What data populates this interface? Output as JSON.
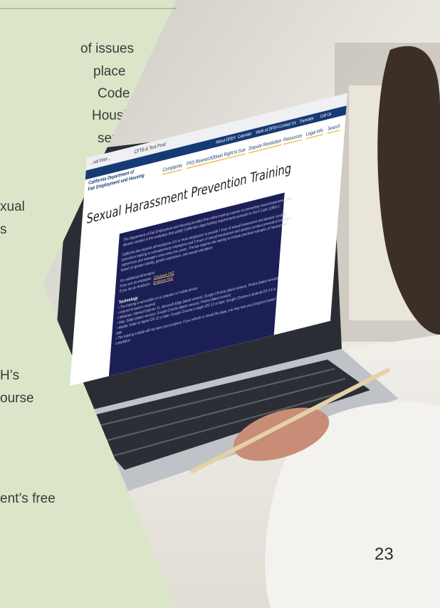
{
  "panel": {
    "lines": [
      "of issues",
      "place",
      "Code",
      "Housing",
      "sexual",
      "xual",
      "s",
      "H’s",
      "ourse",
      "ent’s free"
    ]
  },
  "page_number": "23",
  "laptop_screen": {
    "browser_tabs": [
      "...ual Inter...",
      "CFTB & Text Prod"
    ],
    "top_links": [
      "About DFEH",
      "Calendar",
      "Work at DFEH",
      "Contact Us",
      "Translate",
      "Call Us"
    ],
    "agency_name": [
      "California Department of",
      "Fair Employment and Housing"
    ],
    "nav_items": [
      "Complaints",
      "FRS Research",
      "Obtain Right to Sue",
      "Dispute Resolution",
      "Resources",
      "Legal Info",
      "Search"
    ],
    "page_heading": "Sexual Harassment Prevention Training",
    "content_lines": [
      "The Department of Fair Employment and Housing provides free online training courses on preventing sexual harassment and",
      "abusive conduct in the workplace that satisfy California's legal training requirements pursuant to Gov't Code 12950.1",
      "California law requires all employers of 5 or more employees to provide 1 hour of sexual harassment and abusive conduct",
      "prevention training to nonsupervisory employees and 2 hours of sexual harassment and abusive conduct prevention training to",
      "supervisors and managers once every two years. The law requires the training to include practical examples of harassment",
      "based on gender identity, gender expression, and sexual orientation."
    ],
    "additional_info_label": "For additional information:",
    "info_employee": "If you are an employee: ",
    "info_employee_link": "Employee FAQ",
    "info_employer": "If you are an employer: ",
    "info_employer_link": "Employer FAQ",
    "technology_heading": "Technology",
    "tech_bullets": [
      "• The training is accessible on a computer or mobile device",
      "• Internet browsers required",
      "    • Windows: Internet Explorer 11, Microsoft Edge (latest version), Google Chrome (latest version), Firefox (latest version)",
      "    • Mac: Safari (latest version), Google Chrome (latest version), Firefox (latest version)",
      "    • Mobile: Safari in Apple iOS 12 or later; Google Chrome in Apple iOS 12 or later; Google Chrome in Android OS 4.4 or",
      "      later",
      "• The training module will not save your progress. If you refresh or reload the page, you may lose your progress toward",
      "  completion"
    ]
  },
  "colors": {
    "panel_green": "#dbe6c8",
    "screen_navy": "#1b1f55",
    "accent_gold": "#f2c14e"
  }
}
